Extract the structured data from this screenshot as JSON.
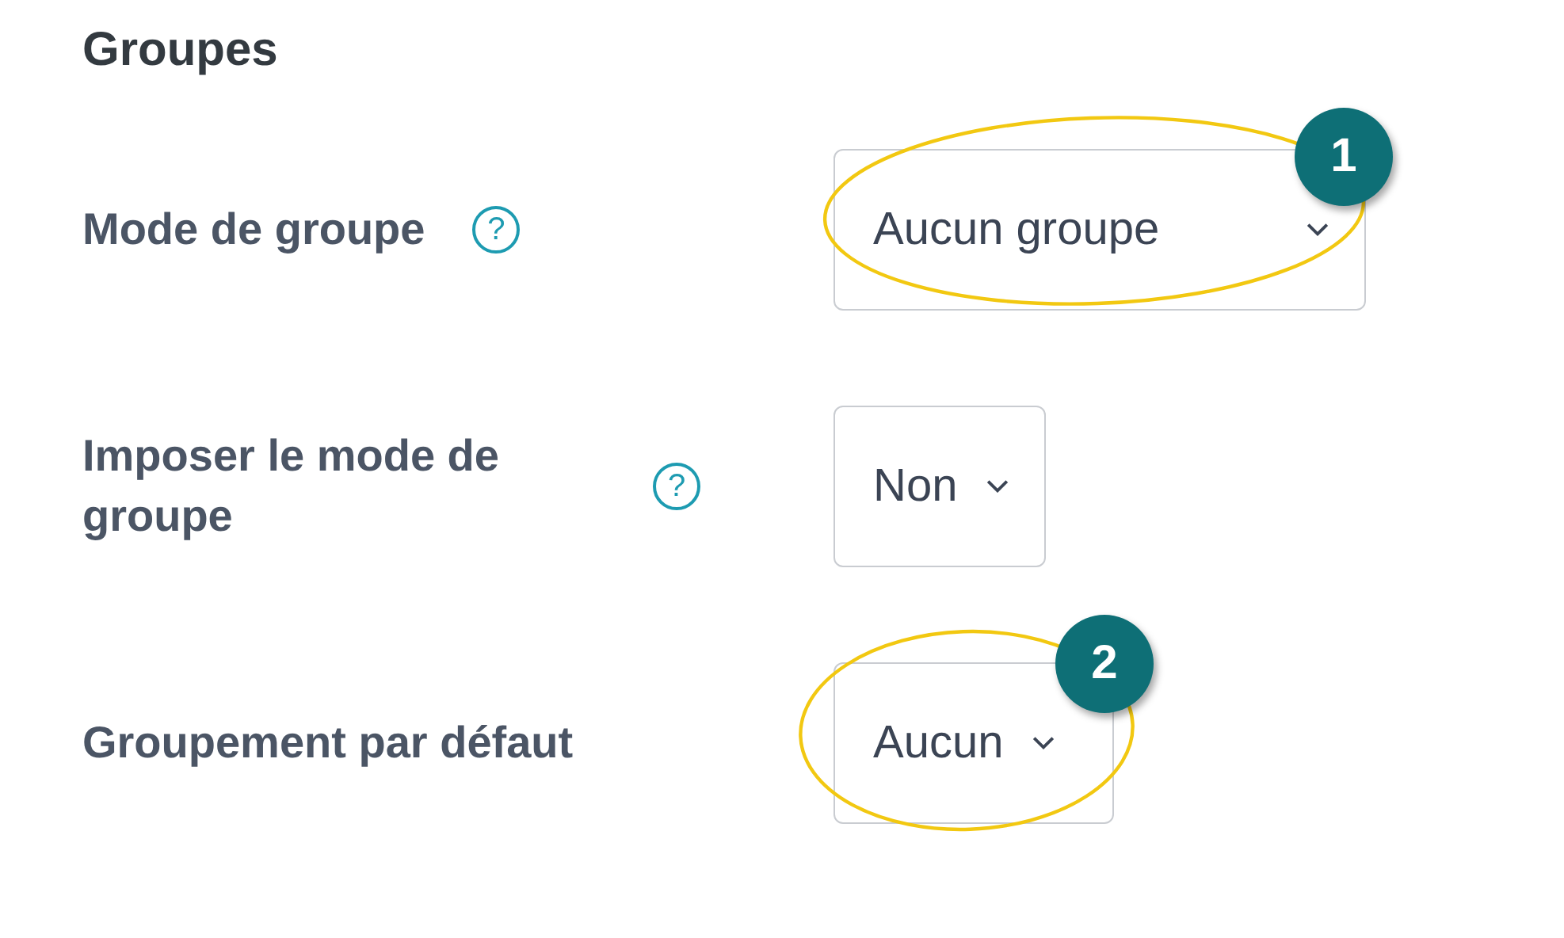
{
  "heading": "Groupes",
  "fields": [
    {
      "label": "Mode de groupe",
      "help": "?",
      "value": "Aucun groupe",
      "annotation": "1"
    },
    {
      "label": "Imposer le mode de groupe",
      "help": "?",
      "value": "Non"
    },
    {
      "label": "Groupement par défaut",
      "value": "Aucun",
      "annotation": "2"
    }
  ]
}
